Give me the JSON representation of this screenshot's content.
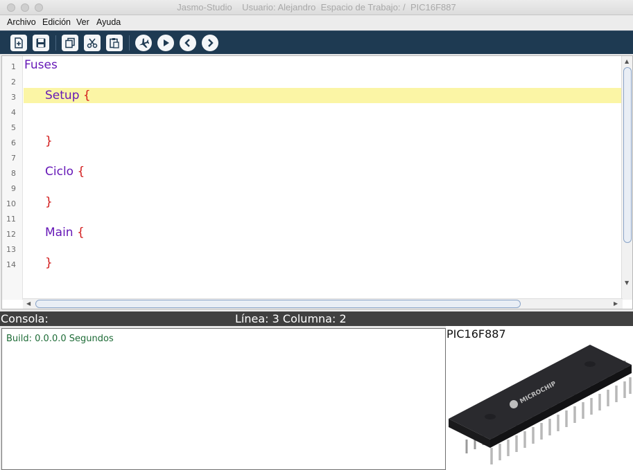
{
  "window": {
    "title": "Jasmo-Studio    Usuario: Alejandro  Espacio de Trabajo: /  PIC16F887"
  },
  "menu": {
    "items": [
      "Archivo",
      "Edición",
      "Ver",
      "Ayuda"
    ]
  },
  "toolbar": {
    "buttons": [
      "new-file-icon",
      "save-icon",
      "copy-icon",
      "cut-icon",
      "paste-icon",
      "deploy-plane-icon",
      "run-icon",
      "back-icon",
      "forward-icon"
    ]
  },
  "editor": {
    "line_numbers": [
      "1",
      "2",
      "3",
      "4",
      "5",
      "6",
      "7",
      "8",
      "9",
      "10",
      "11",
      "12",
      "13",
      "14"
    ],
    "highlighted_line": 3,
    "code": {
      "fuses": "Fuses",
      "setup_kw": "Setup",
      "setup_open": "{",
      "setup_close": "}",
      "ciclo_kw": "Ciclo",
      "ciclo_open": "{",
      "ciclo_close": "}",
      "main_kw": "Main",
      "main_open": "{",
      "main_close": "}"
    },
    "colors": {
      "keyword": "#6618b7",
      "brace": "#d21a1a",
      "current_line": "#fbf5a5"
    }
  },
  "status": {
    "console_label": "Consola:",
    "cursor": "Línea: 3 Columna: 2"
  },
  "console": {
    "output": "Build: 0.0.0.0 Segundos"
  },
  "device": {
    "name": "PIC16F887",
    "chip_marking": "MICROCHIP"
  }
}
